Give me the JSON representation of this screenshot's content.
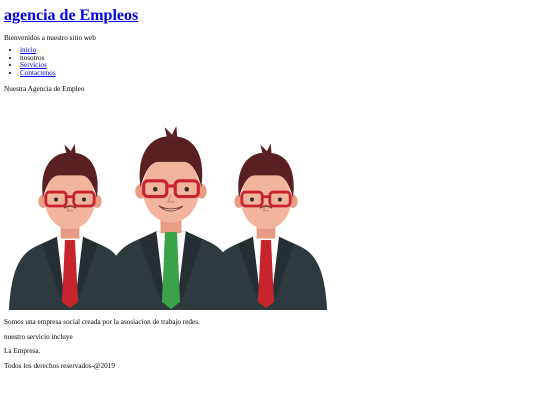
{
  "header": {
    "title": "agencia de Empleos",
    "welcome": "Bienvenidos a nuestro sitio web"
  },
  "nav": {
    "items": [
      {
        "label": "inicio",
        "link": true
      },
      {
        "label": "nosotros",
        "link": false
      },
      {
        "label": "Servicios",
        "link": true
      },
      {
        "label": "Contactenos",
        "link": true
      }
    ]
  },
  "main": {
    "heading": "Nuestra Agencia de Empleo",
    "hero_image": {
      "icon": "three-businessmen-illustration",
      "colors": {
        "suit": "#2f3a3f",
        "hair": "#5a1f22",
        "skin": "#f2b49a",
        "glasses": "#c8242e",
        "tie_side": "#c8242e",
        "tie_center": "#3aa34a"
      }
    },
    "paragraph_1": "Somos una empresa social creada por la asosiacion de trabajo redes.",
    "paragraph_2": "nuestro servicio incluye",
    "paragraph_3": "La Empresa."
  },
  "footer": {
    "text": "Todos los derechos reservados-@2019"
  }
}
